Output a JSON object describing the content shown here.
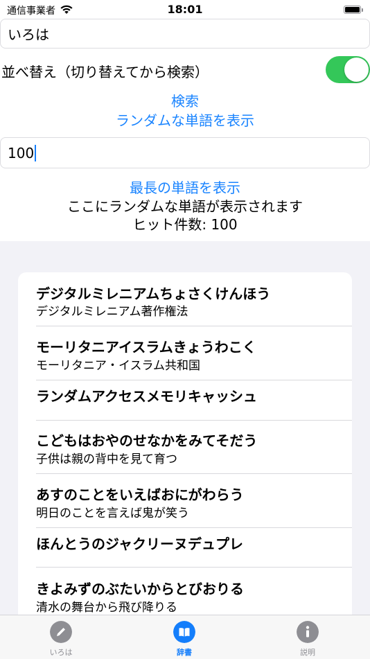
{
  "status_bar": {
    "carrier": "通信事業者",
    "time": "18:01"
  },
  "search": {
    "value": "いろは"
  },
  "sort": {
    "label": "並べ替え（切り替えてから検索）",
    "enabled": true,
    "accent": "#34c759"
  },
  "actions": {
    "search": "検索",
    "random_word": "ランダムな単語を表示"
  },
  "count_input": {
    "value": "100"
  },
  "longest": {
    "label": "最長の単語を表示"
  },
  "random_result": "ここにランダムな単語が表示されます",
  "hit_count": "ヒット件数: 100",
  "results": [
    {
      "word": "デジタルミレニアムちょさくけんほう",
      "meaning": "デジタルミレニアム著作権法"
    },
    {
      "word": "モーリタニアイスラムきょうわこく",
      "meaning": "モーリタニア・イスラム共和国"
    },
    {
      "word": "ランダムアクセスメモリキャッシュ",
      "meaning": ""
    },
    {
      "word": "こどもはおやのせなかをみてそだう",
      "meaning": "子供は親の背中を見て育つ"
    },
    {
      "word": "あすのことをいえばおにがわらう",
      "meaning": "明日のことを言えば鬼が笑う"
    },
    {
      "word": "ほんとうのジャクリーヌデュプレ",
      "meaning": ""
    },
    {
      "word": "きよみずのぶたいからとびおりる",
      "meaning": "清水の舞台から飛び降りる"
    }
  ],
  "tabs": [
    {
      "label": "いろは",
      "icon": "pencil-circle-icon"
    },
    {
      "label": "辞書",
      "icon": "book-circle-icon",
      "active": true,
      "accent": "#147efb"
    },
    {
      "label": "説明",
      "icon": "info-circle-icon"
    }
  ]
}
